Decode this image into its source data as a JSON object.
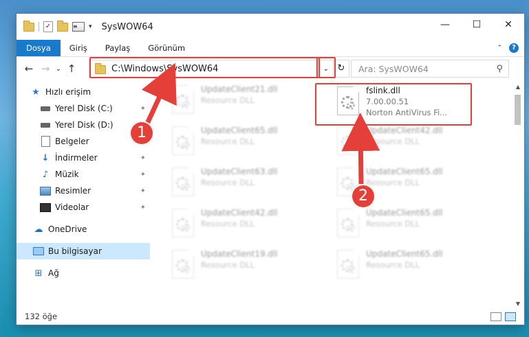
{
  "window": {
    "title": "SysWOW64",
    "controls": [
      "—",
      "☐",
      "✕"
    ]
  },
  "menu": {
    "tabs": [
      {
        "label": "Dosya",
        "active": true
      },
      {
        "label": "Giriş",
        "active": false
      },
      {
        "label": "Paylaş",
        "active": false
      },
      {
        "label": "Görünüm",
        "active": false
      }
    ],
    "collapse_glyph": "⌃",
    "help_glyph": "?"
  },
  "address": {
    "path": "C:\\Windows\\SysWOW64",
    "dropdown_glyph": "⌄",
    "refresh_glyph": "↻"
  },
  "search": {
    "placeholder": "Ara: SysWOW64",
    "icon_glyph": "⚲"
  },
  "nav": {
    "back_glyph": "←",
    "forward_glyph": "→",
    "recent_glyph": "⌄",
    "up_glyph": "↑"
  },
  "sidebar": {
    "items": [
      {
        "label": "Hızlı erişim",
        "icon": "star-icon",
        "pinned": false
      },
      {
        "label": "Yerel Disk (C:)",
        "icon": "drive-icon",
        "pinned": true
      },
      {
        "label": "Yerel Disk (D:)",
        "icon": "drive-icon",
        "pinned": true
      },
      {
        "label": "Belgeler",
        "icon": "documents-icon",
        "pinned": true
      },
      {
        "label": "İndirmeler",
        "icon": "download-icon",
        "pinned": true
      },
      {
        "label": "Müzik",
        "icon": "music-icon",
        "pinned": true
      },
      {
        "label": "Resimler",
        "icon": "pictures-icon",
        "pinned": true
      },
      {
        "label": "Videolar",
        "icon": "videos-icon",
        "pinned": true
      },
      {
        "label": "OneDrive",
        "icon": "cloud-icon",
        "pinned": false
      },
      {
        "label": "Bu bilgisayar",
        "icon": "computer-icon",
        "pinned": false,
        "selected": true
      },
      {
        "label": "Ağ",
        "icon": "network-icon",
        "pinned": false
      }
    ],
    "pin_glyph": "📌"
  },
  "files": [
    {
      "name": "UpdateClient21.dll",
      "type": "Resource DLL",
      "blurred": true
    },
    {
      "name": "fslink.dll",
      "version": "7.00.00.51",
      "description": "Norton AntiVirus Fi...",
      "blurred": false,
      "highlighted": true
    },
    {
      "name": "UpdateClient65.dll",
      "type": "Resource DLL",
      "blurred": true
    },
    {
      "name": "UpdateClient42.dll",
      "type": "Resource DLL",
      "blurred": true
    },
    {
      "name": "UpdateClient63.dll",
      "type": "Resource DLL",
      "blurred": true
    },
    {
      "name": "UpdateClient65.dll",
      "type": "Resource DLL",
      "blurred": true
    },
    {
      "name": "UpdateClient42.dll",
      "type": "Resource DLL",
      "blurred": true
    },
    {
      "name": "UpdateClient65.dll",
      "type": "Resource DLL",
      "blurred": true
    },
    {
      "name": "UpdateClient19.dll",
      "type": "Resource DLL",
      "blurred": true
    },
    {
      "name": "UpdateClient65.dll",
      "type": "Resource DLL",
      "blurred": true
    }
  ],
  "status": {
    "count": "132 öğe"
  },
  "annotations": {
    "step1": "1",
    "step2": "2",
    "color": "#e53f3a"
  }
}
